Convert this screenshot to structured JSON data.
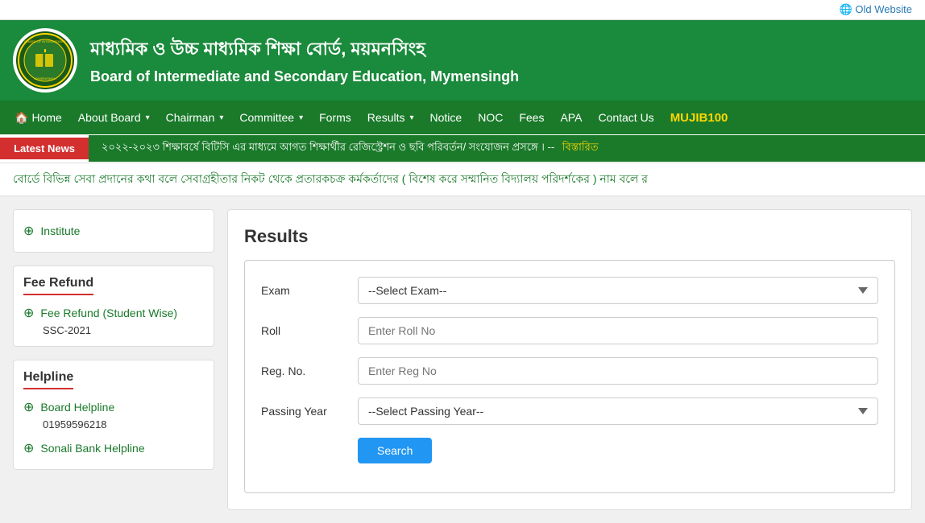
{
  "topbar": {
    "old_website_label": "Old Website",
    "old_website_icon": "🌐"
  },
  "header": {
    "bengali_title": "মাধ্যমিক ও উচ্চ মাধ্যমিক শিক্ষা বোর্ড, ময়মনসিংহ",
    "english_title": "Board of Intermediate and Secondary Education, Mymensingh"
  },
  "nav": {
    "items": [
      {
        "label": "Home",
        "has_icon": true,
        "has_dropdown": false
      },
      {
        "label": "About Board",
        "has_dropdown": true
      },
      {
        "label": "Chairman",
        "has_dropdown": true
      },
      {
        "label": "Committee",
        "has_dropdown": true
      },
      {
        "label": "Forms",
        "has_dropdown": false
      },
      {
        "label": "Results",
        "has_dropdown": true
      },
      {
        "label": "Notice",
        "has_dropdown": false
      },
      {
        "label": "NOC",
        "has_dropdown": false
      },
      {
        "label": "Fees",
        "has_dropdown": false
      },
      {
        "label": "APA",
        "has_dropdown": false
      },
      {
        "label": "Contact Us",
        "has_dropdown": false
      },
      {
        "label": "MUJIB100",
        "has_dropdown": false,
        "special": true
      }
    ]
  },
  "latest_news": {
    "label": "Latest News",
    "text": "২০২২-২০২৩ শিক্ষাবর্ষে বিটিসি এর মাধ্যমে আগত শিক্ষার্থীর রেজিস্ট্রেশন ও ছবি পরিবর্তন/ সংযোজন প্রসঙ্গে । --",
    "link_text": "বিস্তারিত"
  },
  "scroll_notice": {
    "text": "বোর্ডে বিভিন্ন সেবা প্রদানের কথা বলে সেবাগ্রহীতার নিকট থেকে প্রতারকচক্র কর্মকর্তাদের ( বিশেষ করে সম্মানিত বিদ্যালয় পরিদর্শকের ) নাম বলে র"
  },
  "sidebar": {
    "institute_label": "Institute",
    "fee_refund_title": "Fee Refund",
    "fee_refund_link": "Fee Refund (Student Wise)",
    "fee_refund_sub": "SSC-2021",
    "helpline_title": "Helpline",
    "helpline_board_label": "Board Helpline",
    "helpline_board_number": "01959596218",
    "helpline_sonali_label": "Sonali Bank Helpline"
  },
  "results": {
    "title": "Results",
    "exam_label": "Exam",
    "exam_placeholder": "--Select Exam--",
    "roll_label": "Roll",
    "roll_placeholder": "Enter Roll No",
    "reg_label": "Reg. No.",
    "reg_placeholder": "Enter Reg No",
    "passing_year_label": "Passing Year",
    "passing_year_placeholder": "--Select Passing Year--",
    "search_button": "Search"
  }
}
